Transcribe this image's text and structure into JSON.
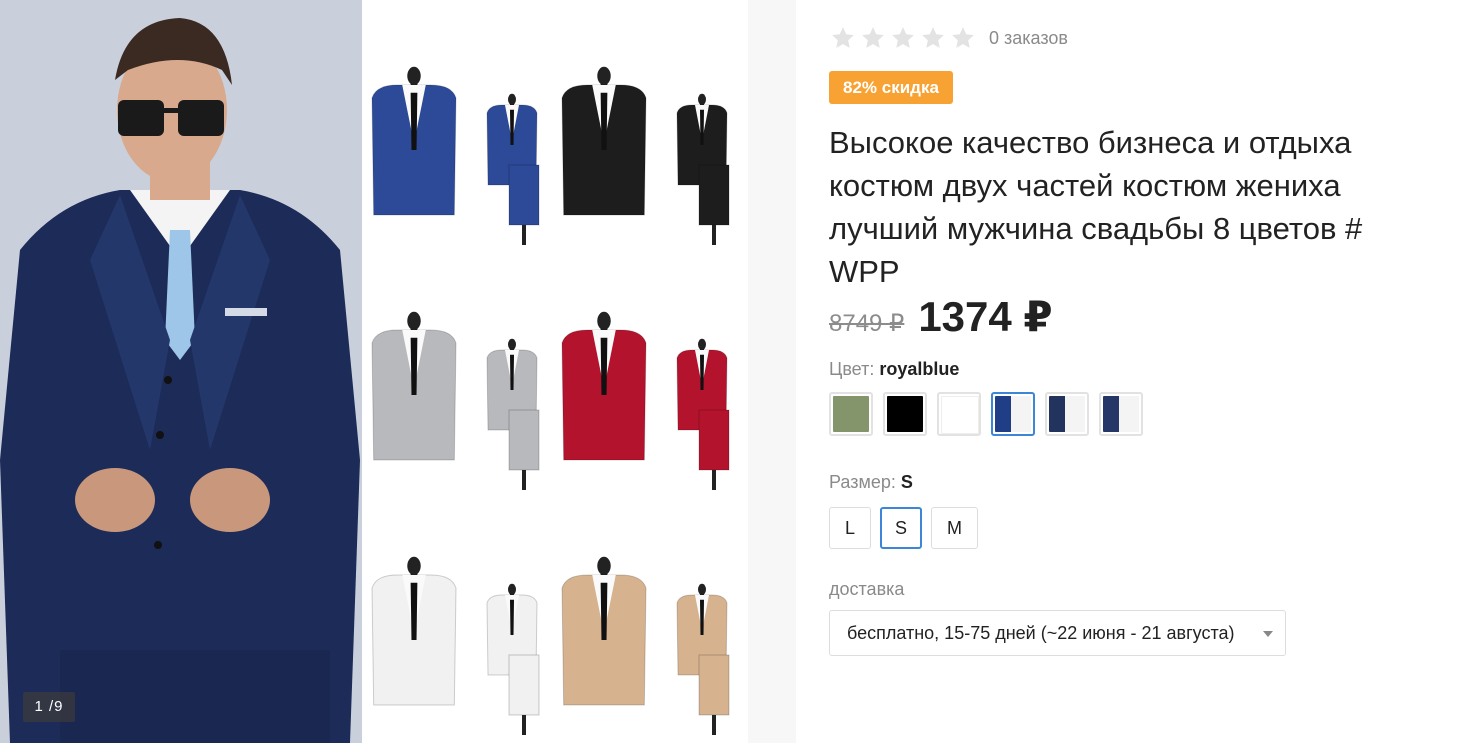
{
  "gallery": {
    "counter": "1 /9",
    "jacket_colors": [
      "#2d4a99",
      "#1d1d1d",
      "#b8b9bd",
      "#b3132c",
      "#f1f1f1",
      "#d6b28e"
    ]
  },
  "product": {
    "rating_stars": 0,
    "orders": "0 заказов",
    "discount": "82% скидка",
    "title": "Высокое качество бизнеса и отдыха костюм двух частей костюм жениха лучший мужчина свадьбы 8 цветов # WPP",
    "old_price": "8749 ₽",
    "price": "1374 ₽"
  },
  "color": {
    "label": "Цвет:",
    "value": "royalblue",
    "swatches": [
      {
        "name": "green",
        "color": "#84956b"
      },
      {
        "name": "black",
        "color": "#000000"
      },
      {
        "name": "white",
        "color": "#ffffff"
      },
      {
        "name": "royalblue",
        "color": "#1f3e86"
      },
      {
        "name": "navy",
        "color": "#22335e"
      },
      {
        "name": "darkblue",
        "color": "#243766"
      }
    ],
    "selected": "royalblue"
  },
  "size": {
    "label": "Размер:",
    "value": "S",
    "options": [
      "L",
      "S",
      "M"
    ],
    "selected": "S"
  },
  "delivery": {
    "label": "доставка",
    "value": "бесплатно, 15-75 дней (~22 июня - 21 августа)"
  }
}
